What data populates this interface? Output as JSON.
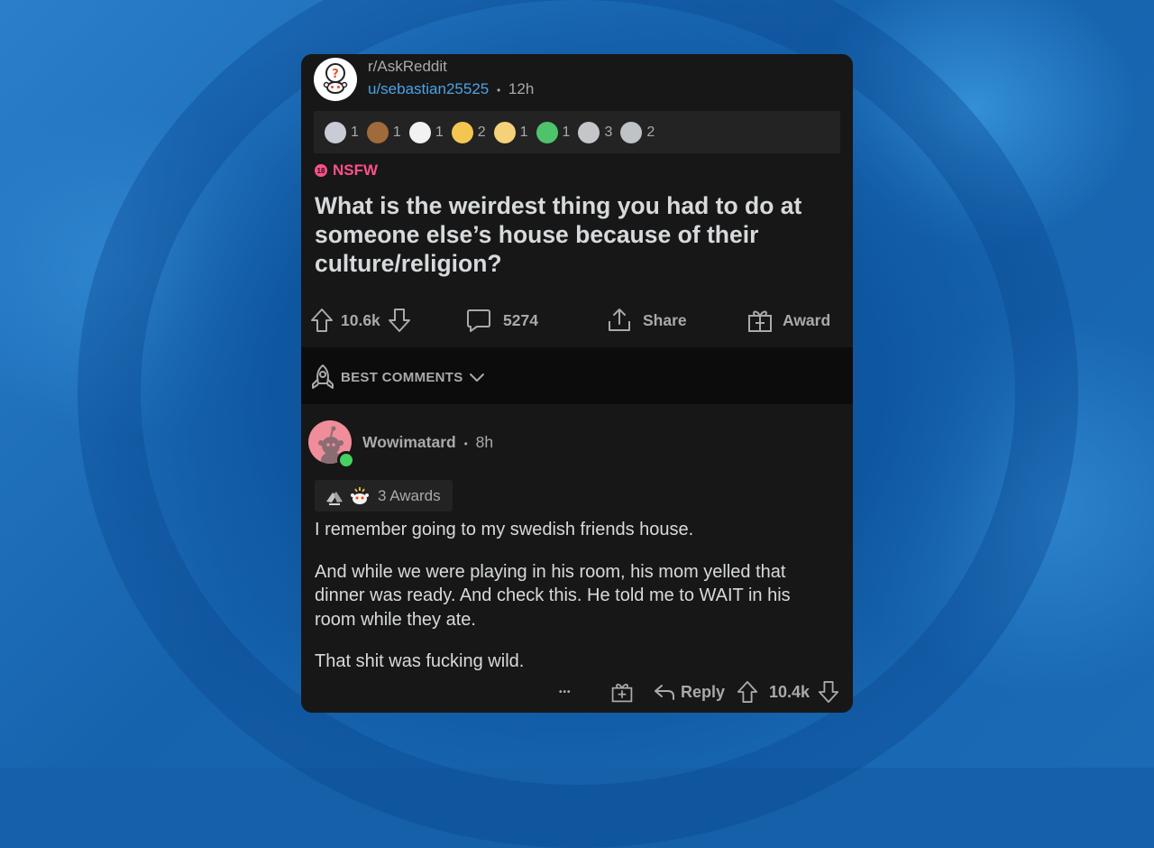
{
  "post": {
    "subreddit": "r/AskReddit",
    "author": "u/sebastian25525",
    "separator": "•",
    "age": "12h",
    "awards": [
      {
        "icon": "helpful-award-icon",
        "count": "1",
        "color": "#c9ccd4"
      },
      {
        "icon": "bear-award-icon",
        "count": "1",
        "color": "#a06a3a"
      },
      {
        "icon": "snoo-award-icon",
        "count": "1",
        "color": "#f2f2f2"
      },
      {
        "icon": "wholesome-award-icon",
        "count": "2",
        "color": "#f3c64f"
      },
      {
        "icon": "confetti-award-icon",
        "count": "1",
        "color": "#f5d27a"
      },
      {
        "icon": "rocket-like-award-icon",
        "count": "1",
        "color": "#4fc36b"
      },
      {
        "icon": "silver-coin-award-icon",
        "count": "3",
        "color": "#c4c6ca"
      },
      {
        "icon": "hands-award-icon",
        "count": "2",
        "color": "#bfc2c7"
      }
    ],
    "nsfw_label": "NSFW",
    "nsfw_badge": "18",
    "title": "What is the weirdest thing you had to do at someone else’s house because of their culture/religion?",
    "votes": "10.6k",
    "comments": "5274",
    "share_label": "Share",
    "award_label": "Award"
  },
  "sort": {
    "label": "BEST COMMENTS"
  },
  "comment": {
    "author": "Wowimatard",
    "separator": "•",
    "age": "8h",
    "awards_label": "3 Awards",
    "paragraphs": [
      "I remember going to my swedish friends house.",
      "And while we were playing in his room, his mom yelled that dinner was ready. And check this. He told me to WAIT in his room while they ate.",
      "That shit was fucking wild."
    ],
    "more": "•••",
    "reply_label": "Reply",
    "votes": "10.4k"
  },
  "colors": {
    "accent_nsfw": "#ff4f8b",
    "link": "#4aa3e6",
    "online": "#46d160",
    "card_bg": "#171717"
  }
}
